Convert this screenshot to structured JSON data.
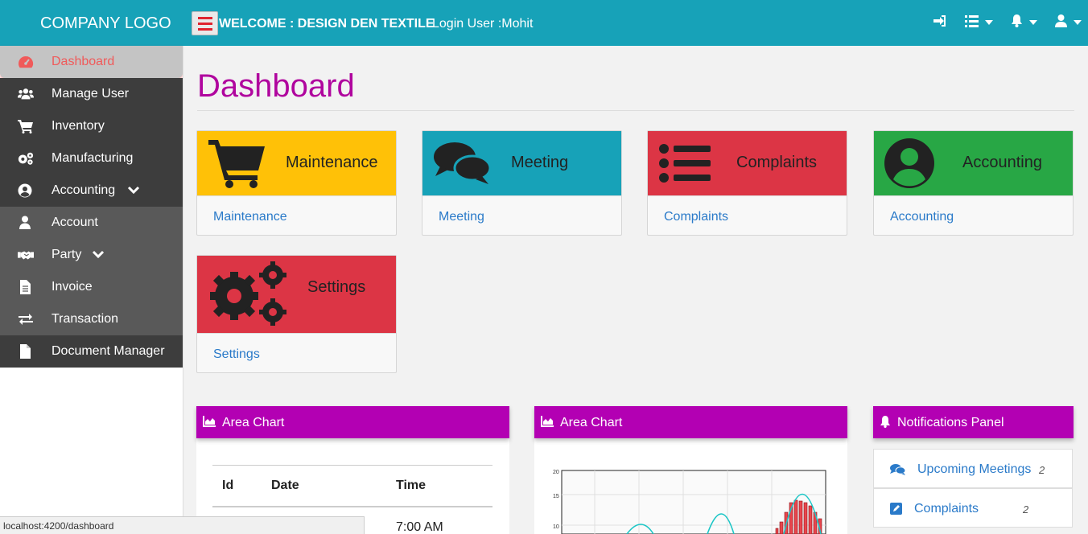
{
  "header": {
    "logo": "COMPANY LOGO",
    "welcome": "WELCOME : DESIGN DEN TEXTILE",
    "login_user": "Login User :Mohit"
  },
  "sidebar": {
    "items": [
      {
        "label": "Dashboard",
        "icon": "dashboard-icon"
      },
      {
        "label": "Manage User",
        "icon": "users-icon"
      },
      {
        "label": "Inventory",
        "icon": "cart-icon"
      },
      {
        "label": "Manufacturing",
        "icon": "gears-icon"
      },
      {
        "label": "Accounting",
        "icon": "user-circle-icon"
      },
      {
        "label": "Account",
        "icon": "user-icon"
      },
      {
        "label": "Party",
        "icon": "handshake-icon"
      },
      {
        "label": "Invoice",
        "icon": "file-text-icon"
      },
      {
        "label": "Transaction",
        "icon": "exchange-icon"
      },
      {
        "label": "Document Manager",
        "icon": "file-icon"
      }
    ]
  },
  "main": {
    "title": "Dashboard",
    "cards": [
      {
        "title": "Maintenance",
        "link": "Maintenance",
        "color": "#ffc107"
      },
      {
        "title": "Meeting",
        "link": "Meeting",
        "color": "#17a2b8"
      },
      {
        "title": "Complaints",
        "link": "Complaints",
        "color": "#dc3545"
      },
      {
        "title": "Accounting",
        "link": "Accounting",
        "color": "#28a745"
      },
      {
        "title": "Settings",
        "link": "Settings",
        "color": "#dc3545"
      }
    ],
    "panels": {
      "area_chart_1": {
        "title": "Area Chart",
        "table": {
          "headers": [
            "Id",
            "Date",
            "Time"
          ],
          "rows": [
            [
              "",
              "",
              "7:00 AM"
            ]
          ]
        }
      },
      "area_chart_2": {
        "title": "Area Chart",
        "y_ticks": [
          "20",
          "15",
          "10"
        ]
      },
      "notifications": {
        "title": "Notifications Panel",
        "items": [
          {
            "label": "Upcoming Meetings",
            "count": "2"
          },
          {
            "label": "Complaints",
            "count": "2"
          }
        ]
      }
    }
  },
  "statusbar": {
    "url": "localhost:4200/dashboard"
  },
  "colors": {
    "topbar": "#17a2b8",
    "accent": "#b300b3",
    "link": "#2a7ac9"
  }
}
